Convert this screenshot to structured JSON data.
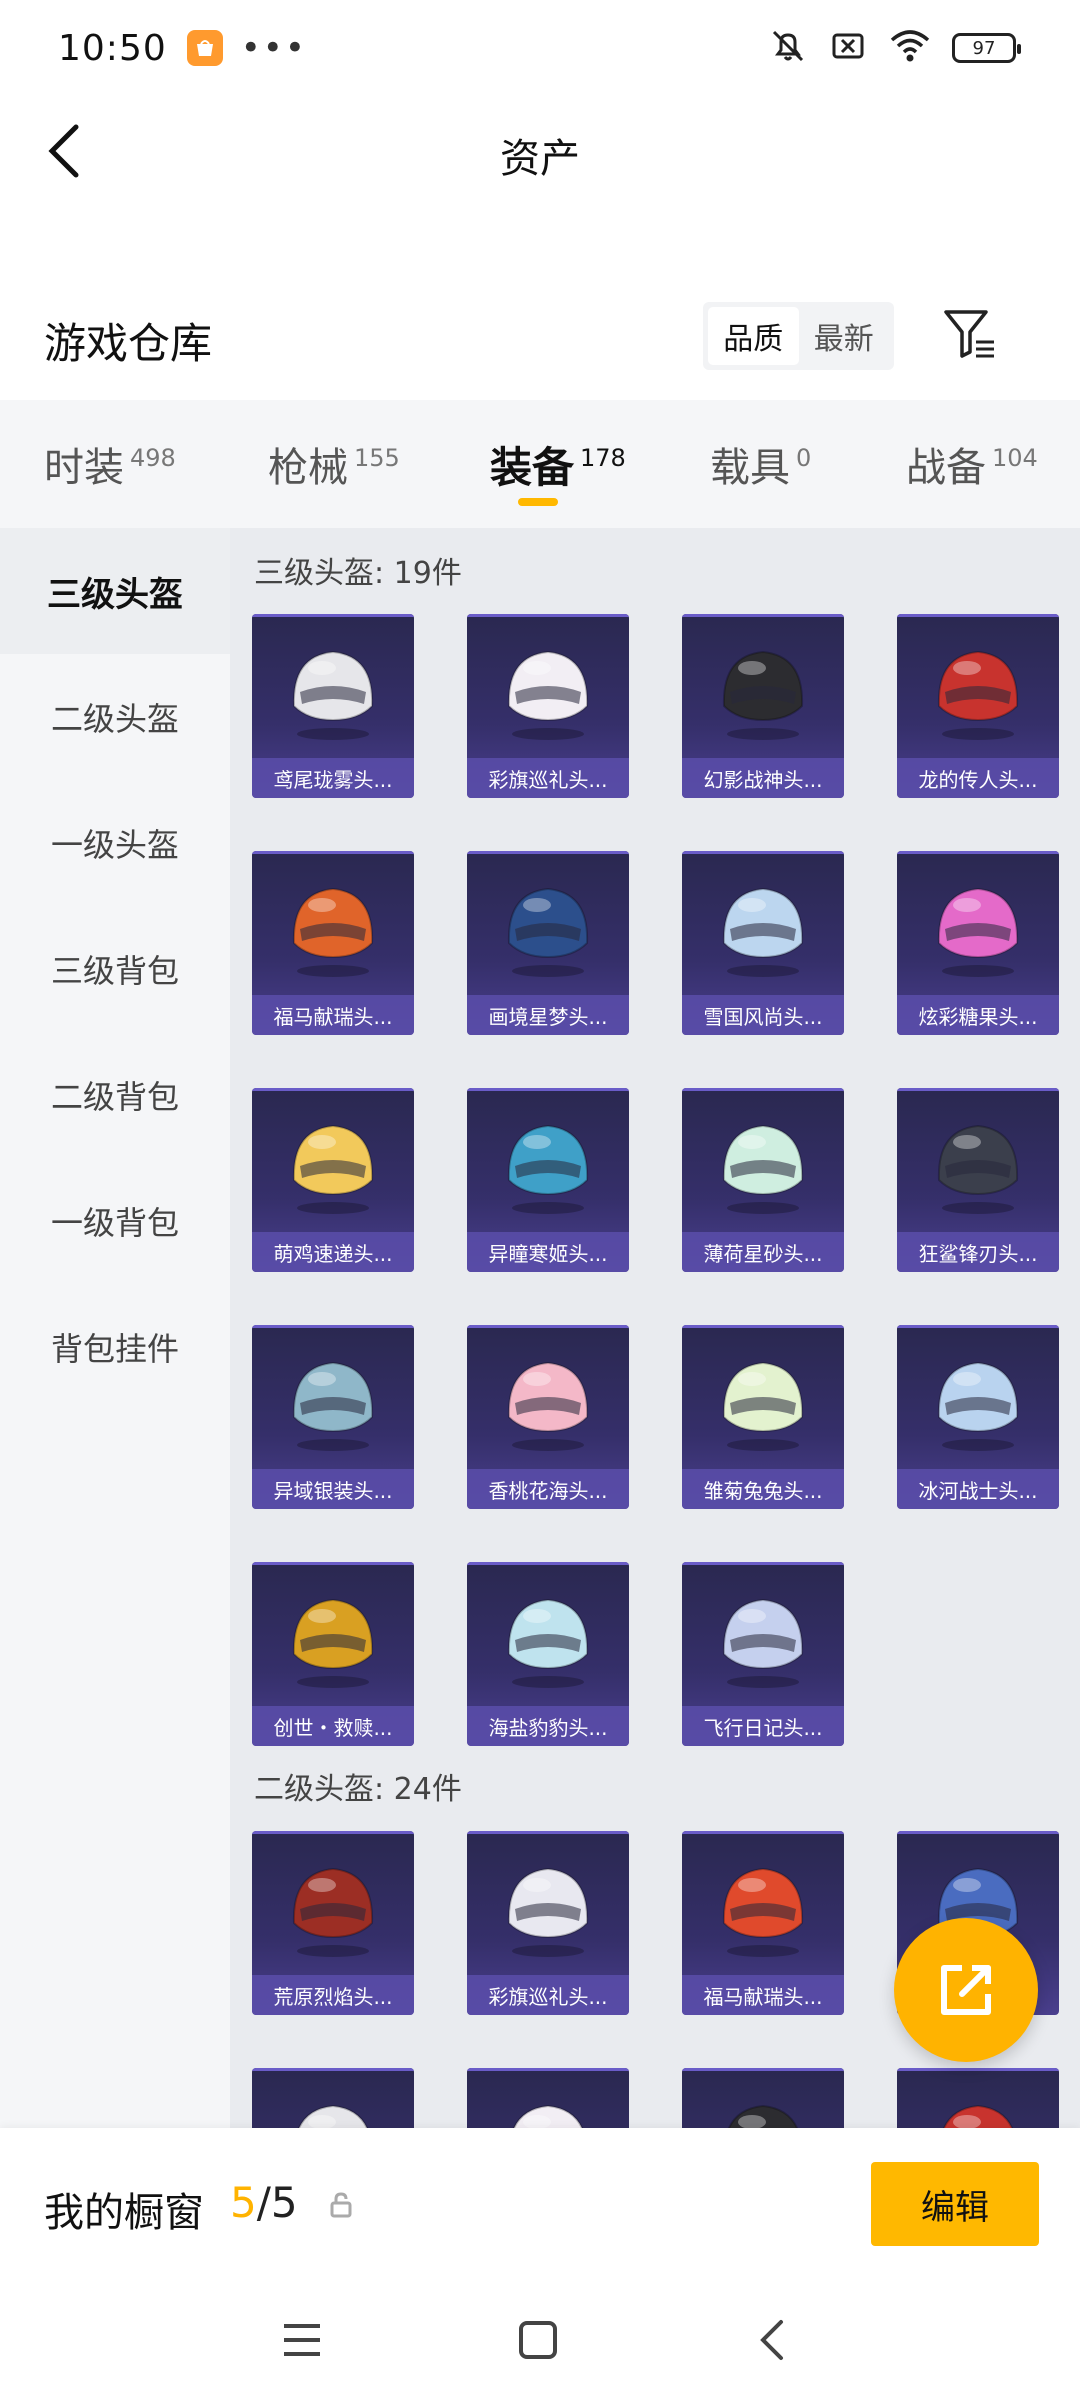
{
  "status_bar": {
    "time": "10:50",
    "battery": "97",
    "more": "•••"
  },
  "header": {
    "title": "资产"
  },
  "warehouse": {
    "title": "游戏仓库",
    "sort_quality": "品质",
    "sort_newest": "最新"
  },
  "tabs": [
    {
      "label": "时装",
      "count": "498"
    },
    {
      "label": "枪械",
      "count": "155"
    },
    {
      "label": "装备",
      "count": "178"
    },
    {
      "label": "载具",
      "count": "0"
    },
    {
      "label": "战备",
      "count": "104"
    }
  ],
  "sidebar": {
    "items": [
      "三级头盔",
      "二级头盔",
      "一级头盔",
      "三级背包",
      "二级背包",
      "一级背包",
      "背包挂件"
    ]
  },
  "sections": [
    {
      "title": "三级头盔: 19件",
      "items": [
        "鸢尾珑雾头...",
        "彩旗巡礼头...",
        "幻影战神头...",
        "龙的传人头...",
        "福马献瑞头...",
        "画境星梦头...",
        "雪国风尚头...",
        "炫彩糖果头...",
        "萌鸡速递头...",
        "异瞳寒姬头...",
        "薄荷星砂头...",
        "狂鲨锋刃头...",
        "异域银装头...",
        "香桃花海头...",
        "雏菊兔兔头...",
        "冰河战士头...",
        "创世・救赎...",
        "海盐豹豹头...",
        "飞行日记头..."
      ]
    },
    {
      "title": "二级头盔: 24件",
      "items": [
        "荒原烈焰头...",
        "彩旗巡礼头...",
        "福马献瑞头...",
        ""
      ]
    }
  ],
  "bottom": {
    "label": "我的橱窗",
    "current": "5",
    "total": "/5",
    "edit": "编辑"
  },
  "colors": {
    "accent": "#ffb800",
    "card_bg": "#2e2a5e",
    "card_label": "#5a4eaa"
  },
  "helmet_colors": [
    "#e6e6ea",
    "#f2eef4",
    "#2c2c30",
    "#c8332e",
    "#e0642a",
    "#2c4f8c",
    "#bcd6ef",
    "#e46ac9",
    "#f2c95b",
    "#3fa0c8",
    "#cfeee0",
    "#3b3f4c",
    "#8fb7c9",
    "#f4b8c8",
    "#e3f2cf",
    "#b9d3ef",
    "#d9a022",
    "#bfe3ee",
    "#c5d0ee",
    "#9c2e24",
    "#e8e8f0",
    "#e04a2c",
    "#4a6cc0"
  ]
}
